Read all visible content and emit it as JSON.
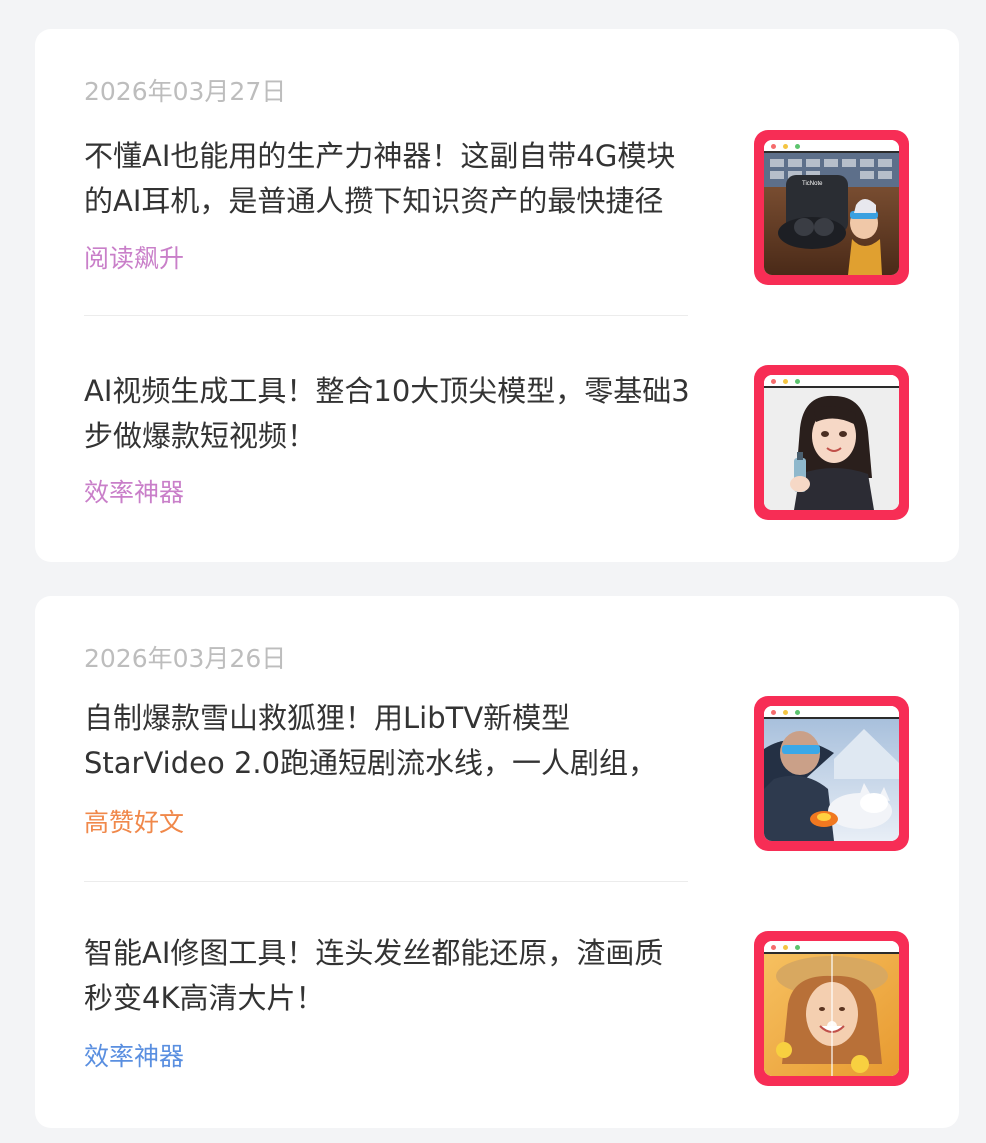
{
  "colors": {
    "page_bg": "#f3f4f6",
    "card_bg": "#ffffff",
    "date": "#bdbdbd",
    "title": "#333333",
    "thumb_frame": "#f72d55",
    "dot_red": "#f56c6c",
    "dot_yellow": "#f4c542",
    "dot_green": "#5cc46e"
  },
  "groups": [
    {
      "date": "2026年03月27日",
      "articles": [
        {
          "title": "不懂AI也能用的生产力神器！这副自带4G模块的AI耳机，是普通人攒下知识资产的最快捷径",
          "tag": "阅读飙升",
          "tag_color": "#c97fc9",
          "thumbnail_icon": "earbuds-thumbnail",
          "thumbnail_text": "TicNote"
        },
        {
          "title": "AI视频生成工具！整合10大顶尖模型，零基础3步做爆款短视频！",
          "tag": "效率神器",
          "tag_color": "#c97fc9",
          "thumbnail_icon": "woman-portrait-thumbnail"
        }
      ]
    },
    {
      "date": "2026年03月26日",
      "articles": [
        {
          "title": "自制爆款雪山救狐狸！用LibTV新模型StarVideo 2.0跑通短剧流水线，一人剧组，",
          "tag": "高赞好文",
          "tag_color": "#f0884a",
          "thumbnail_icon": "snow-fox-thumbnail"
        },
        {
          "title": "智能AI修图工具！连头发丝都能还原，渣画质秒变4K高清大片！",
          "tag": "效率神器",
          "tag_color": "#5a8fe0",
          "thumbnail_icon": "smiling-woman-thumbnail"
        }
      ]
    }
  ]
}
